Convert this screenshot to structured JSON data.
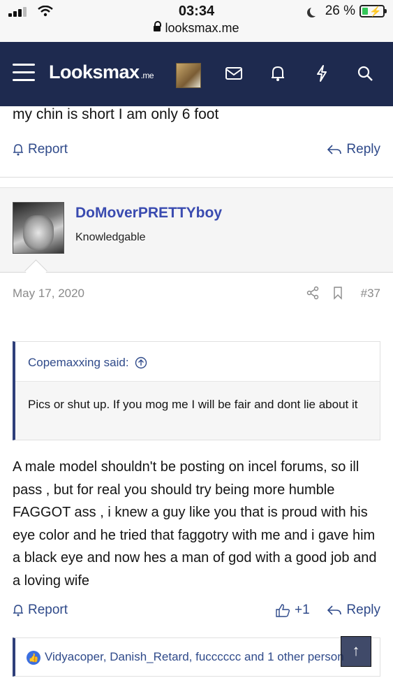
{
  "status": {
    "time": "03:34",
    "url": "looksmax.me",
    "battery": "26 %"
  },
  "nav": {
    "logo_main": "Looksmax",
    "logo_suffix": ".me"
  },
  "previous_post": {
    "text": "my chin is short I am only 6 foot",
    "report_label": "Report",
    "reply_label": "Reply"
  },
  "post": {
    "username": "DoMoverPRETTYboy",
    "user_title": "Knowledgable",
    "date": "May 17, 2020",
    "number": "#37",
    "quote": {
      "author": "Copemaxxing said:",
      "text": "Pics or shut up. If you mog me I will be fair and dont lie about it"
    },
    "body": "A male model shouldn't be posting on incel forums, so ill pass , but for real you should try being more humble FAGGOT ass , i knew a guy like you that is proud with his eye color and he tried that faggotry with me and i gave him a black eye and now hes a man of god with a good job and a loving wife",
    "report_label": "Report",
    "like_count": "+1",
    "reply_label": "Reply",
    "reactions_text": "Vidyacoper, Danish_Retard, fucccccc and 1 other person"
  },
  "colors": {
    "nav_bg": "#1e2a4f",
    "link": "#2f4a8a",
    "username": "#3a4bb0"
  }
}
